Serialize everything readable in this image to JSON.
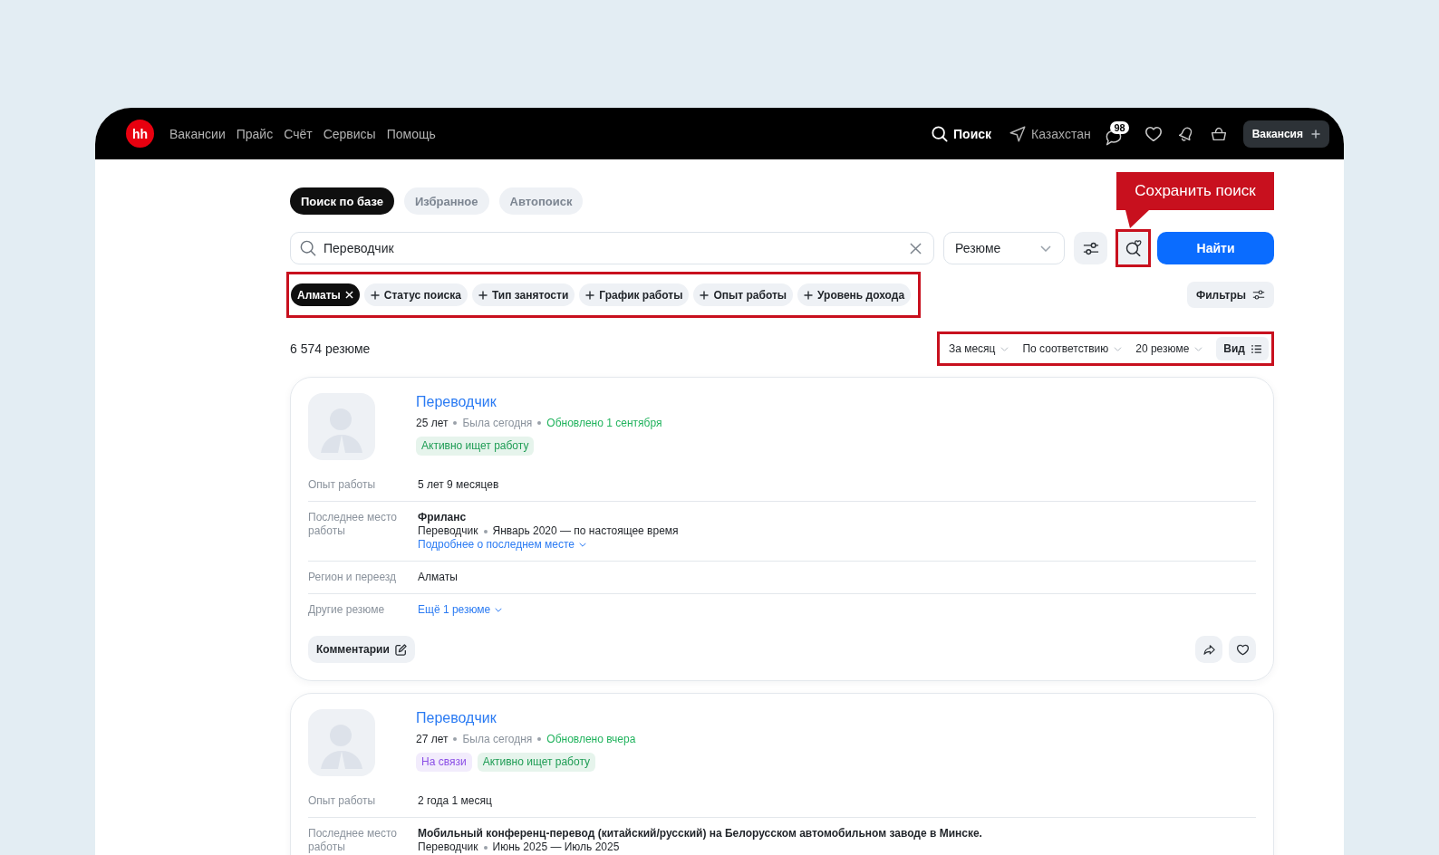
{
  "header": {
    "logo": "hh",
    "nav": [
      "Вакансии",
      "Прайс",
      "Счёт",
      "Сервисы",
      "Помощь"
    ],
    "search": "Поиск",
    "region": "Казахстан",
    "messages_count": "98",
    "create_button": "Вакансия"
  },
  "tabs": [
    {
      "label": "Поиск по базе",
      "selected": true
    },
    {
      "label": "Избранное",
      "selected": false
    },
    {
      "label": "Автопоиск",
      "selected": false
    }
  ],
  "search": {
    "value": "Переводчик",
    "resume_type": "Резюме",
    "save_highlighted": true,
    "save_tooltip": "Сохранить поиск",
    "submit": "Найти"
  },
  "chips": {
    "highlighted": true,
    "items": [
      {
        "label": "Алматы",
        "selected": true
      },
      {
        "label": "Статус поиска",
        "selected": false
      },
      {
        "label": "Тип занятости",
        "selected": false
      },
      {
        "label": "График работы",
        "selected": false
      },
      {
        "label": "Опыт работы",
        "selected": false
      },
      {
        "label": "Уровень дохода",
        "selected": false
      }
    ]
  },
  "filters_button": "Фильтры",
  "results": {
    "count": "6 574 резюме",
    "highlighted": true,
    "controls": [
      {
        "label": "За месяц",
        "kind": "dropdown"
      },
      {
        "label": "По соответствию",
        "kind": "dropdown"
      },
      {
        "label": "20 резюме",
        "kind": "dropdown"
      },
      {
        "label": "Вид",
        "kind": "view"
      }
    ]
  },
  "cards": [
    {
      "title": "Переводчик",
      "meta": [
        {
          "text": "25 лет",
          "kind": "age"
        },
        {
          "text": "Была сегодня",
          "kind": "seen"
        },
        {
          "text": "Обновлено 1 сентября",
          "kind": "updated"
        }
      ],
      "tags": [
        {
          "label": "Активно ищет работу",
          "color": "#1f9d55"
        }
      ],
      "details": [
        {
          "label": "Опыт работы",
          "kind": "text",
          "value": "5 лет 9 месяцев"
        },
        {
          "label": "Последнее место работы",
          "kind": "job",
          "company": "Фриланс",
          "position": "Переводчик",
          "period": "Январь 2020 — по настоящее время",
          "link": "Подробнее о последнем месте"
        },
        {
          "label": "Регион и переезд",
          "kind": "text",
          "value": "Алматы"
        },
        {
          "label": "Другие резюме",
          "kind": "link",
          "value": "Ещё 1 резюме"
        }
      ],
      "footer": {
        "comments": "Комментарии",
        "favorited": false
      }
    },
    {
      "title": "Переводчик",
      "meta": [
        {
          "text": "27 лет",
          "kind": "age"
        },
        {
          "text": "Была сегодня",
          "kind": "seen"
        },
        {
          "text": "Обновлено вчера",
          "kind": "updated"
        }
      ],
      "tags": [
        {
          "label": "На связи",
          "color": "#8b4fe6"
        },
        {
          "label": "Активно ищет работу",
          "color": "#1f9d55"
        }
      ],
      "details": [
        {
          "label": "Опыт работы",
          "kind": "text",
          "value": "2 года 1 месяц"
        },
        {
          "label": "Последнее место работы",
          "kind": "job",
          "company": "Мобильный конференц-перевод (китайский/русский) на Белорусском автомобильном заводе в Минске.",
          "position": "Переводчик",
          "period": "Июнь 2025 — Июль 2025"
        }
      ]
    }
  ]
}
